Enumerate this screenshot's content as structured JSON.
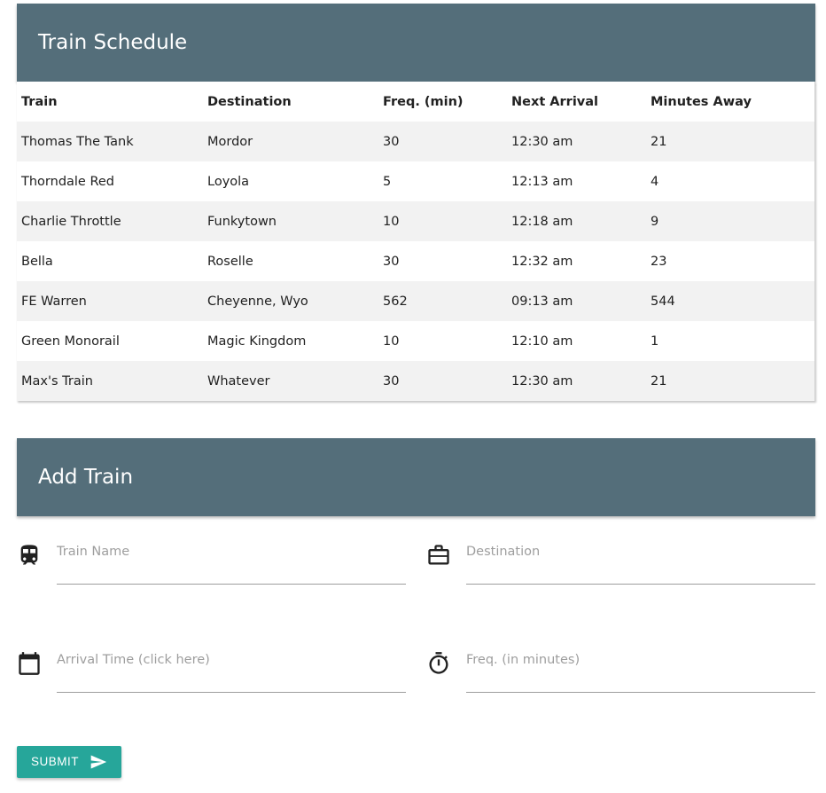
{
  "schedule": {
    "title": "Train Schedule",
    "columns": [
      "Train",
      "Destination",
      "Freq. (min)",
      "Next Arrival",
      "Minutes Away"
    ],
    "rows": [
      [
        "Thomas The Tank",
        "Mordor",
        "30",
        "12:30 am",
        "21"
      ],
      [
        "Thorndale Red",
        "Loyola",
        "5",
        "12:13 am",
        "4"
      ],
      [
        "Charlie Throttle",
        "Funkytown",
        "10",
        "12:18 am",
        "9"
      ],
      [
        "Bella",
        "Roselle",
        "30",
        "12:32 am",
        "23"
      ],
      [
        "FE Warren",
        "Cheyenne, Wyo",
        "562",
        "09:13 am",
        "544"
      ],
      [
        "Green Monorail",
        "Magic Kingdom",
        "10",
        "12:10 am",
        "1"
      ],
      [
        "Max's Train",
        "Whatever",
        "30",
        "12:30 am",
        "21"
      ]
    ]
  },
  "add_train": {
    "title": "Add Train",
    "train_name": {
      "placeholder": "Train Name",
      "value": "",
      "icon": "train-icon"
    },
    "destination": {
      "placeholder": "Destination",
      "value": "",
      "icon": "briefcase-icon"
    },
    "arrival_time": {
      "placeholder": "Arrival Time (click here)",
      "value": "",
      "icon": "calendar-icon"
    },
    "frequency": {
      "placeholder": "Freq. (in minutes)",
      "value": "",
      "icon": "timer-icon"
    },
    "submit_label": "SUBMIT",
    "submit_icon": "send-icon"
  },
  "colors": {
    "header_bg": "#546e7a",
    "button_bg": "#26a69a",
    "stripe": "#f2f2f2"
  }
}
